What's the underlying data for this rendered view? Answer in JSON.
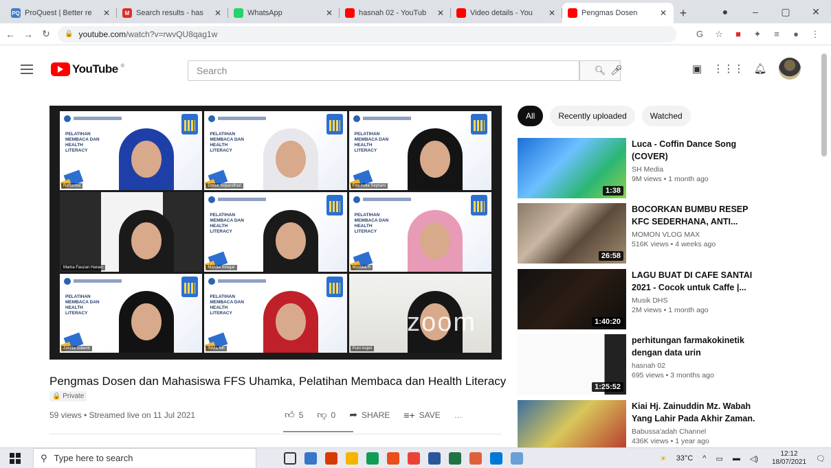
{
  "browser": {
    "tabs": [
      {
        "title": "ProQuest | Better re",
        "icon": "proquest-icon",
        "favtext": "PQ",
        "color": "#3d7cc9",
        "active": false
      },
      {
        "title": "Search results - has",
        "icon": "gmail-icon",
        "favtext": "M",
        "color": "#d93025",
        "active": false
      },
      {
        "title": "WhatsApp",
        "icon": "whatsapp-icon",
        "favtext": "",
        "color": "#25d366",
        "active": false
      },
      {
        "title": "hasnah 02 - YouTub",
        "icon": "youtube-icon",
        "favtext": "",
        "color": "#ff0000",
        "active": false
      },
      {
        "title": "Video details - You",
        "icon": "youtube-studio-icon",
        "favtext": "",
        "color": "#ff0000",
        "active": false
      },
      {
        "title": "Pengmas Dosen",
        "icon": "youtube-icon",
        "favtext": "",
        "color": "#ff0000",
        "active": true
      }
    ],
    "url_host": "youtube.com",
    "url_path": "/watch?v=rwvQU8qag1w"
  },
  "youtube": {
    "logo_text": "YouTube",
    "search_placeholder": "Search"
  },
  "video": {
    "title": "Pengmas Dosen dan Mahasiswa FFS Uhamka, Pelatihan Membaca dan Health Literacy",
    "privacy": "Private",
    "meta": "59 views • Streamed live on 11 Jul 2021",
    "likes": "5",
    "dislikes": "0",
    "share_label": "SHARE",
    "save_label": "SAVE",
    "more_label": "…",
    "slide_text": "PELATIHAN MEMBACA DAN HEALTH LITERACY",
    "watermark": "zoom",
    "participants": [
      {
        "name": "Raftanisa",
        "type": "slide",
        "hijab": "#1f3fa8"
      },
      {
        "name": "Dwiek Sepandhari",
        "type": "slide",
        "hijab": "#e8e8ec"
      },
      {
        "name": "Fira Aulia Septiani",
        "type": "slide",
        "hijab": "#141414"
      },
      {
        "name": "Mama Fauzan Hanan",
        "type": "dark",
        "hijab": "#1a1a1a"
      },
      {
        "name": "Mardia Siregar",
        "type": "slide",
        "hijab": "#1a1a1a"
      },
      {
        "name": "Mustika R",
        "type": "slide",
        "hijab": "#e79bb7"
      },
      {
        "name": "Zelvita Jubenti",
        "type": "slide",
        "hijab": "#121212"
      },
      {
        "name": "Silvia NR",
        "type": "slide",
        "hijab": "#c0202a"
      },
      {
        "name": "Putri Anjeli",
        "type": "room",
        "hijab": "#161616"
      }
    ]
  },
  "chips": [
    "All",
    "Recently uploaded",
    "Watched"
  ],
  "recommendations": [
    {
      "title": "Luca - Coffin Dance Song (COVER)",
      "channel": "SH Media",
      "views": "9M views • 1 month ago",
      "duration": "1:38",
      "thumb": "linear-gradient(135deg,#1d6fd8 0%,#6cc0ff 40%,#2bb673 70%,#8fd14f 100%)"
    },
    {
      "title": "BOCORKAN BUMBU RESEP KFC SEDERHANA, ANTI...",
      "channel": "MOMON VLOG MAX",
      "views": "516K views • 4 weeks ago",
      "duration": "26:58",
      "thumb": "linear-gradient(135deg,#8a7a66 0%,#c9b6a3 35%,#5c4b3b 60%,#a08c70 100%)"
    },
    {
      "title": "LAGU BUAT DI CAFE SANTAI 2021 - Cocok untuk Caffe |...",
      "channel": "Musik DHS",
      "views": "2M views • 1 month ago",
      "duration": "1:40:20",
      "thumb": "linear-gradient(135deg,#111 0%,#2b1d14 50%,#0c0c0c 100%)"
    },
    {
      "title": "perhitungan farmakokinetik dengan data urin",
      "channel": "hasnah 02",
      "views": "695 views • 3 months ago",
      "duration": "1:25:52",
      "thumb": "linear-gradient(90deg,#fafafa 0%,#fafafa 80%,#222 80%,#222 100%)"
    },
    {
      "title": "Kiai Hj. Zainuddin Mz. Wabah Yang Lahir Pada Akhir Zaman.",
      "channel": "Babussa'adah Channel",
      "views": "436K views • 1 year ago",
      "duration": "",
      "thumb": "linear-gradient(135deg,#3b6fa0 0%,#d9c65a 45%,#b22a2a 100%)"
    }
  ],
  "taskbar": {
    "search_placeholder": "Type here to search",
    "weather": "33°C",
    "time": "12:12",
    "date": "18/07/2021",
    "apps": [
      "#1e90ff",
      "#3776c9",
      "#d83b01",
      "#f4b400",
      "#0f9d58",
      "#e94e1b",
      "#ea4335",
      "#2b579a",
      "#217346",
      "#e0603a",
      "#0078d7",
      "#6a9fd8"
    ]
  }
}
